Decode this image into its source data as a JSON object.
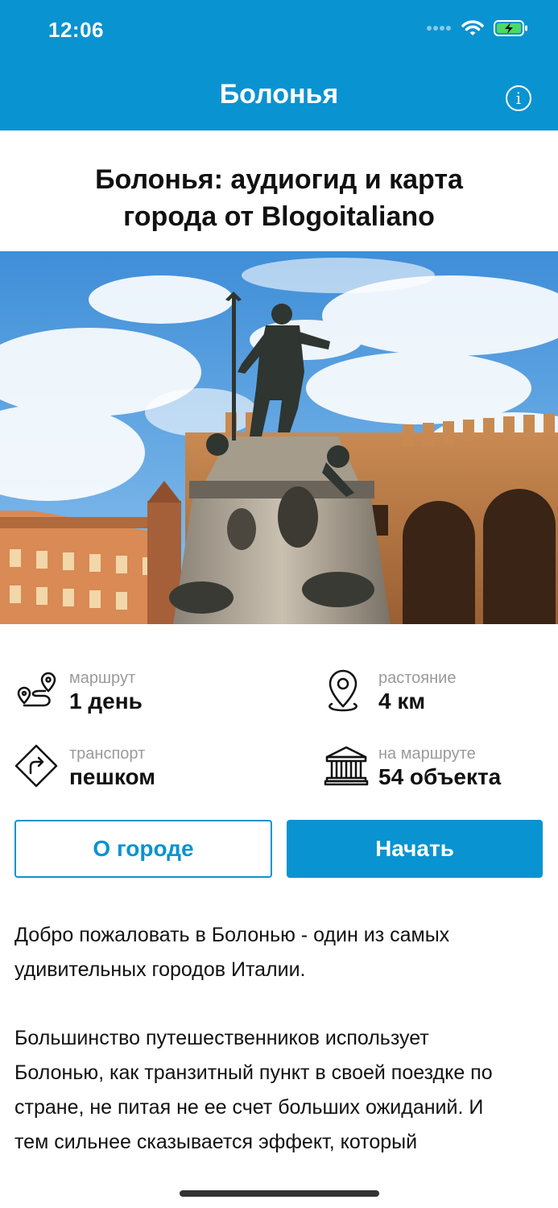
{
  "status_bar": {
    "time": "12:06"
  },
  "nav": {
    "title": "Болонья",
    "info_icon": "info-icon"
  },
  "guide": {
    "title_line1": "Болонья: аудиогид и карта",
    "title_line2": "города от Blogoitaliano"
  },
  "stats": {
    "route_label": "маршрут",
    "route_value": "1 день",
    "distance_label": "растояние",
    "distance_value": "4 км",
    "transport_label": "транспорт",
    "transport_value": "пешком",
    "objects_label": "на маршруте",
    "objects_value": "54 объекта"
  },
  "buttons": {
    "about": "О городе",
    "start": "Начать"
  },
  "description": {
    "p1_line1": "Добро пожаловать в Болонью - один из самых",
    "p1_line2": "удивительных городов Италии.",
    "p2_line1": "Большинство путешественников использует",
    "p2_line2": "Болонью, как транзитный пункт в своей поездке по",
    "p2_line3": "стране, не питая не ее счет больших ожиданий. И",
    "p2_line4": "тем сильнее сказывается эффект, который"
  },
  "colors": {
    "accent": "#0a93d1"
  }
}
